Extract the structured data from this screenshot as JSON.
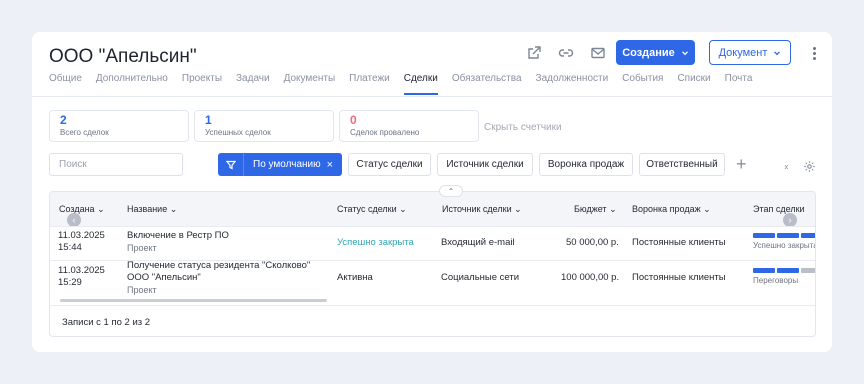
{
  "company": {
    "title": "ООО \"Апельсин\""
  },
  "header": {
    "icons": [
      "external-link-icon",
      "link-icon",
      "mail-icon"
    ],
    "create_label": "Создание",
    "document_label": "Документ"
  },
  "tabs": [
    {
      "label": "Общие",
      "active": false
    },
    {
      "label": "Дополнительно",
      "active": false
    },
    {
      "label": "Проекты",
      "active": false
    },
    {
      "label": "Задачи",
      "active": false
    },
    {
      "label": "Документы",
      "active": false
    },
    {
      "label": "Платежи",
      "active": false
    },
    {
      "label": "Сделки",
      "active": true
    },
    {
      "label": "Обязательства",
      "active": false
    },
    {
      "label": "Задолженности",
      "active": false
    },
    {
      "label": "События",
      "active": false
    },
    {
      "label": "Списки",
      "active": false
    },
    {
      "label": "Почта",
      "active": false
    }
  ],
  "counters": [
    {
      "value": "2",
      "label": "Всего сделок",
      "color": "#2f68e6"
    },
    {
      "value": "1",
      "label": "Успешных сделок",
      "color": "#2f68e6"
    },
    {
      "value": "0",
      "label": "Сделок провалено",
      "color": "#f06a7a"
    }
  ],
  "hide_counters_label": "Скрыть счетчики",
  "filters": {
    "search_placeholder": "Поиск",
    "preset_label": "По умолчанию",
    "chips": [
      "Статус сделки",
      "Источник сделки",
      "Воронка продаж",
      "Ответственный"
    ]
  },
  "table": {
    "columns": [
      "Создана",
      "Название",
      "Статус сделки",
      "Источник сделки",
      "Бюджет",
      "Воронка продаж",
      "Этап сделки"
    ],
    "rows": [
      {
        "date": "11.03.2025",
        "time": "15:44",
        "name_lines": [
          "Включение в Рестр ПО"
        ],
        "type": "Проект",
        "status": "Успешно закрыта",
        "source": "Входящий e-mail",
        "budget": "50 000,00 р.",
        "funnel": "Постоянные клиенты",
        "stage": "Успешно закрыта"
      },
      {
        "date": "11.03.2025",
        "time": "15:29",
        "name_lines": [
          "Получение статуса резидента \"Сколково\"",
          "ООО \"Апельсин\""
        ],
        "type": "Проект",
        "status": "Активна",
        "source": "Социальные сети",
        "budget": "100 000,00 р.",
        "funnel": "Постоянные клиенты",
        "stage": "Переговоры"
      }
    ],
    "footer": "Записи с 1 по 2 из 2"
  },
  "colors": {
    "accent": "#2f68e6",
    "link": "#2fa7b8",
    "failed": "#f06a7a",
    "stage_done": "#2f68e6",
    "stage_todo": "#b9bec9"
  }
}
